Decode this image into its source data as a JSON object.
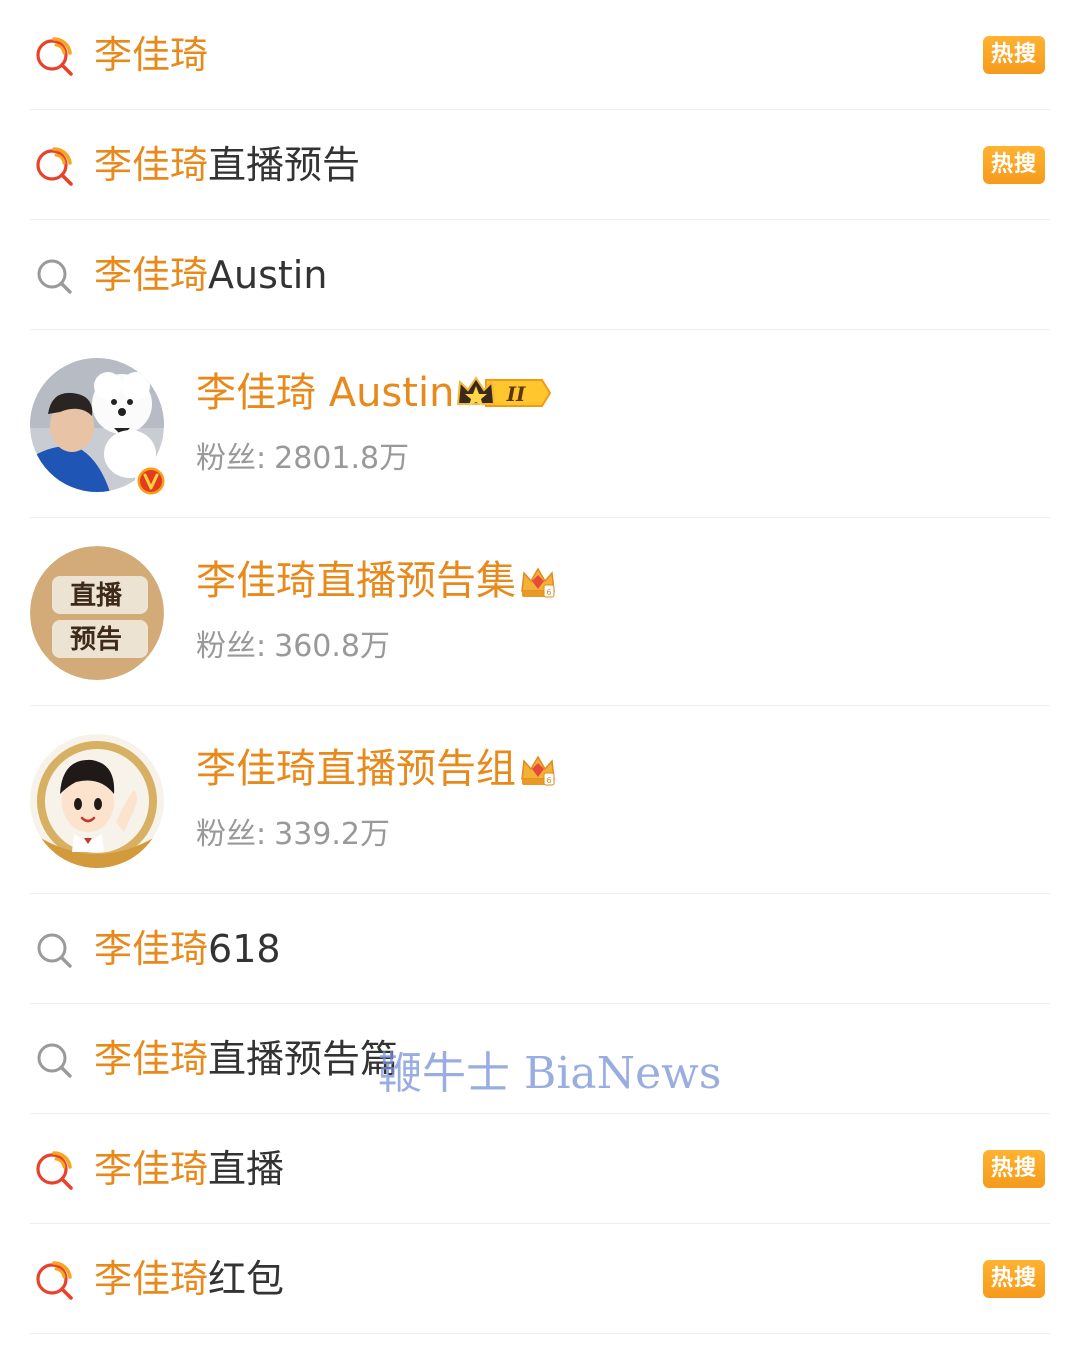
{
  "accent_color": "#e8891c",
  "badge_color": "#f7a21f",
  "suggestions_top": [
    {
      "highlight": "李佳琦",
      "rest": "",
      "icon": "hot-search-icon",
      "badge": "热搜"
    },
    {
      "highlight": "李佳琦",
      "rest": "直播预告",
      "icon": "hot-search-icon",
      "badge": "热搜"
    },
    {
      "highlight": "李佳琦",
      "rest": "Austin",
      "icon": "search-icon",
      "badge": ""
    }
  ],
  "users": [
    {
      "name": "李佳琦 Austin",
      "fans_label": "粉丝:",
      "fans_value": "2801.8万",
      "avatar": "photo-avatar",
      "verified": true,
      "badge_icon": "crown-level-badge-icon"
    },
    {
      "name": "李佳琦直播预告集",
      "fans_label": "粉丝:",
      "fans_value": "360.8万",
      "avatar": "live-preview-avatar",
      "avatar_text": [
        "直播",
        "预告"
      ],
      "verified": false,
      "badge_icon": "gem-crown-icon"
    },
    {
      "name": "李佳琦直播预告组",
      "fans_label": "粉丝:",
      "fans_value": "339.2万",
      "avatar": "cartoon-avatar",
      "verified": false,
      "badge_icon": "gem-crown-icon"
    }
  ],
  "suggestions_bottom": [
    {
      "highlight": "李佳琦",
      "rest": "618",
      "icon": "search-icon",
      "badge": ""
    },
    {
      "highlight": "李佳琦",
      "rest": "直播预告篇",
      "icon": "search-icon",
      "badge": ""
    },
    {
      "highlight": "李佳琦",
      "rest": "直播",
      "icon": "hot-search-icon",
      "badge": "热搜"
    },
    {
      "highlight": "李佳琦",
      "rest": "红包",
      "icon": "hot-search-icon",
      "badge": "热搜"
    }
  ],
  "watermark": "鞭牛士 BiaNews"
}
